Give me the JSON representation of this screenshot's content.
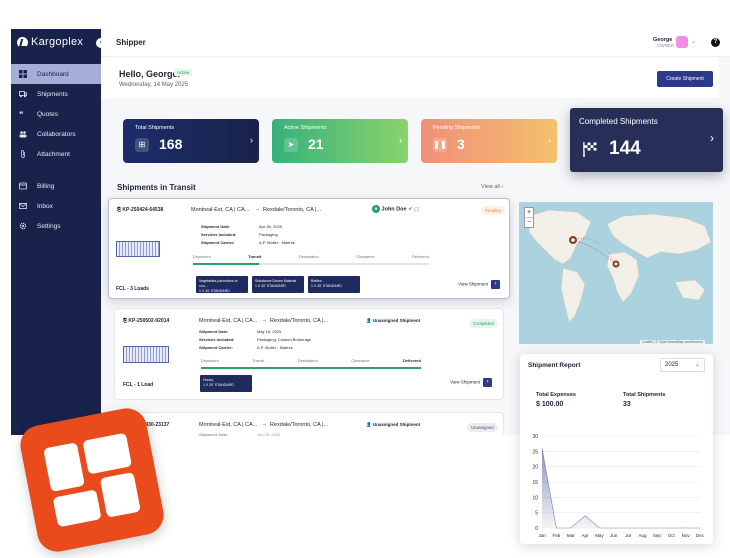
{
  "sidebar": {
    "logo": "Kargoplex",
    "items": [
      {
        "label": "Dashboard",
        "icon": "grid-icon"
      },
      {
        "label": "Shipments",
        "icon": "truck-icon"
      },
      {
        "label": "Quotes",
        "icon": "quote-icon"
      },
      {
        "label": "Collaborators",
        "icon": "users-icon"
      },
      {
        "label": "Attachment",
        "icon": "paperclip-icon"
      },
      {
        "label": "Billing",
        "icon": "billing-icon"
      },
      {
        "label": "Inbox",
        "icon": "mail-icon"
      },
      {
        "label": "Settings",
        "icon": "gear-icon"
      }
    ]
  },
  "header": {
    "title": "Shipper",
    "user_name": "George",
    "user_role": "OWNER",
    "avatar_initial": "G"
  },
  "greeting": {
    "text": "Hello, George!",
    "status": "Active",
    "date": "Wednesday, 14 May 2025",
    "create_button": "Create Shipment"
  },
  "stats": [
    {
      "label": "Total Shipments",
      "value": "168",
      "icon": "grid-icon"
    },
    {
      "label": "Active Shipments",
      "value": "21",
      "icon": "send-icon"
    },
    {
      "label": "Pending Shipments",
      "value": "3",
      "icon": "pause-icon"
    },
    {
      "label": "Completed Shipments",
      "value": "144",
      "icon": "flag-icon"
    }
  ],
  "transit": {
    "title": "Shipments in Transit",
    "view_all": "View all"
  },
  "shipments": [
    {
      "id": "KP-250424-64538",
      "origin": "Montreal-Est, CA | CA...",
      "dest": "Rexdale/Toronto, CA |...",
      "assignee": "John Doe",
      "status": "Pending",
      "date_label": "Shipment Date:",
      "date": "Apr 26, 2025",
      "services_label": "Services Included:",
      "services": "Packaging",
      "carrier_label": "Shipment Carrier:",
      "carrier": "A.P. Moller - Maersk",
      "steps": [
        "Departure",
        "Transit",
        "Destination",
        "Clearance",
        "Delivered"
      ],
      "progress": 0.28,
      "tags": [
        "Vegetables (uncooked or coo...",
        "Substance Drums Material",
        "Bottles"
      ],
      "tag_sub": [
        "1 X 20' STANDARD",
        "1 X 20' STANDARD",
        "1 X 20' STANDARD"
      ],
      "fcl": "FCL - 3 Loads",
      "view": "View Shipment"
    },
    {
      "id": "KP-250502-92014",
      "origin": "Montreal-Est, CA | CA...",
      "dest": "Rexdale/Toronto, CA |...",
      "assignee": "Unassigned Shipment",
      "status": "Completed",
      "date_label": "Shipment Date:",
      "date": "May 16, 2025",
      "services_label": "Services Included:",
      "services": "Packaging, Custom Brokerage",
      "carrier_label": "Shipment Carrier:",
      "carrier": "A.P. Moller - Maersk",
      "steps": [
        "Departure",
        "Transit",
        "Destination",
        "Clearance",
        "Delivered"
      ],
      "progress": 1,
      "tags": [
        "Honey"
      ],
      "tag_sub": [
        "1 X 20' STANDARD"
      ],
      "fcl": "FCL - 1 Load",
      "view": "View Shipment"
    },
    {
      "id": "KP-250430-23137",
      "origin": "Montreal-Est, CA | CA...",
      "dest": "Rexdale/Toronto, CA |...",
      "assignee": "Unassigned Shipment",
      "status": "Unassigned",
      "date_label": "Shipment Date:",
      "date": "Jun 25, 2025"
    }
  ],
  "map": {
    "attribution": "Leaflet | © OpenStreetMap contributors",
    "zoom_in": "+",
    "zoom_out": "−"
  },
  "report": {
    "title": "Shipment Report",
    "year": "2025",
    "expenses_label": "Total Expenses",
    "expenses_value": "$ 100.00",
    "shipments_label": "Total Shipments",
    "shipments_value": "33"
  },
  "chart_data": {
    "type": "area",
    "categories": [
      "Jan",
      "Feb",
      "Mar",
      "Apr",
      "May",
      "Jun",
      "Jul",
      "Aug",
      "Sep",
      "Oct",
      "Nov",
      "Dec"
    ],
    "series": [
      {
        "values": [
          26,
          0,
          0,
          4,
          0,
          0,
          0,
          0,
          0,
          0,
          0,
          0
        ]
      }
    ],
    "ylim": [
      0,
      30
    ],
    "yticks": [
      0,
      5,
      10,
      15,
      20,
      25,
      30
    ],
    "color": "#2d3a8c"
  },
  "colors": {
    "sidebar": "#19224a",
    "primary": "#2d3a8c",
    "success": "#2aa165",
    "pending": "#e58b39",
    "brand_badge": "#ea4b1c"
  }
}
